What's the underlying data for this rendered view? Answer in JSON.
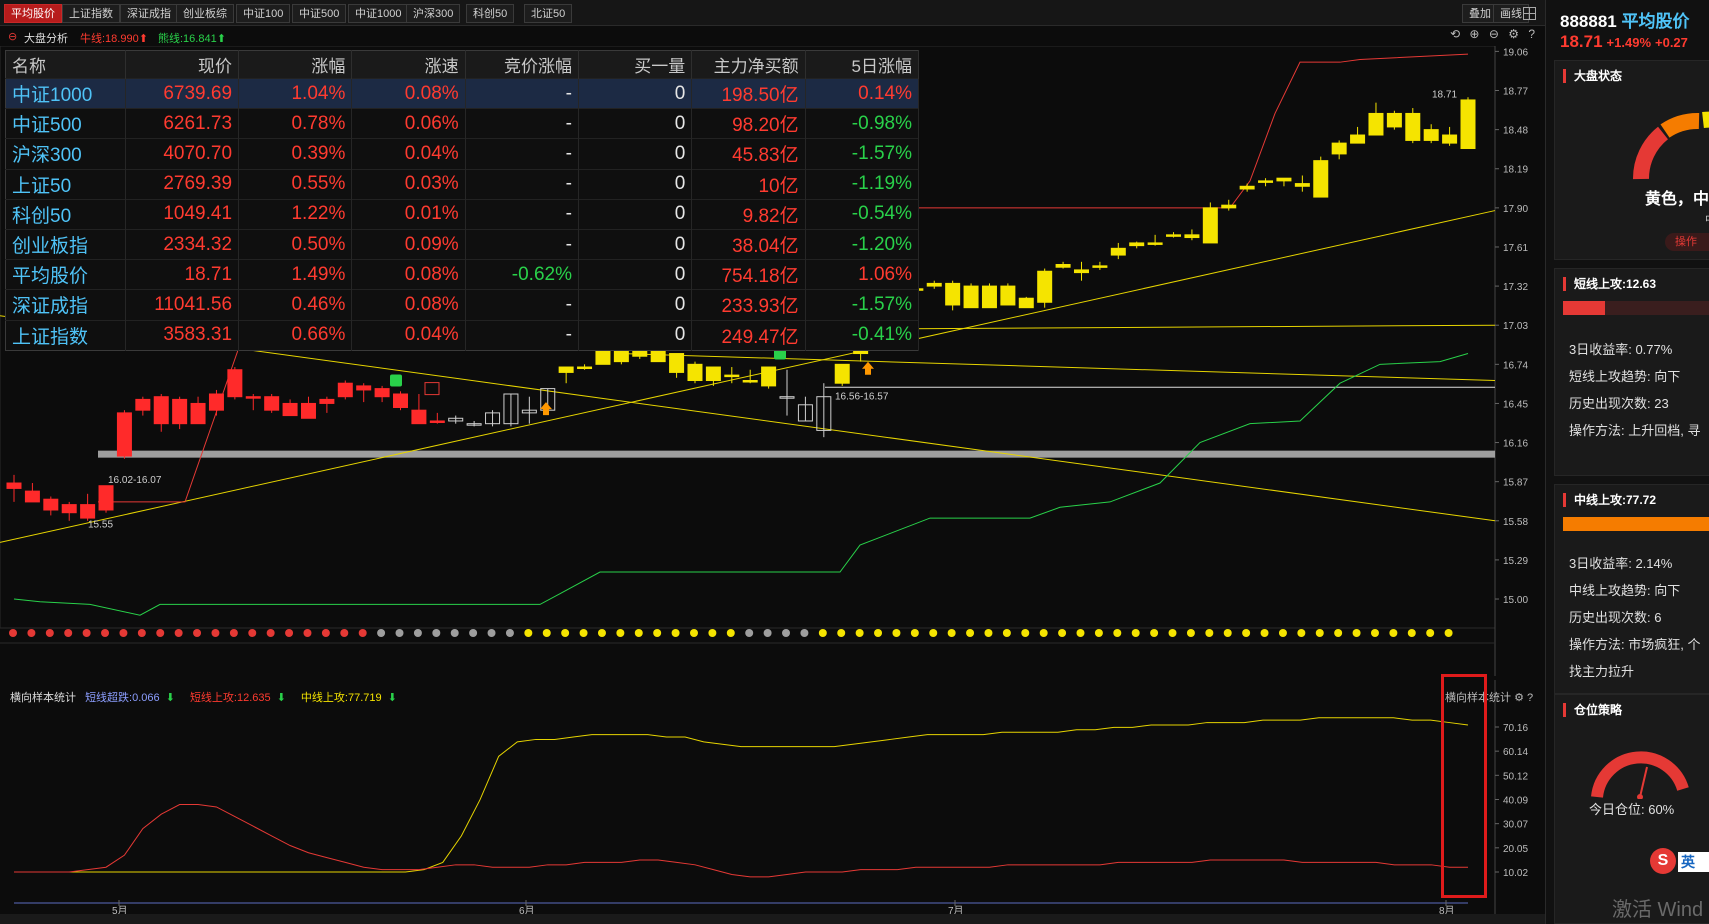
{
  "tabs": [
    "平均股价",
    "上证指数",
    "深证成指",
    "创业板综",
    "中证100",
    "中证500",
    "中证1000",
    "沪深300",
    "科创50",
    "北证50"
  ],
  "active_tab": "平均股价",
  "toolbar": {
    "overlay": "叠加",
    "draw": "画线"
  },
  "info": {
    "analysis": "大盘分析",
    "bull": "牛线:18.990",
    "bear": "熊线:16.841"
  },
  "quote_table": {
    "columns": [
      "名称",
      "现价",
      "涨幅",
      "涨速",
      "竞价涨幅",
      "买一量",
      "主力净买额",
      "5日涨幅"
    ],
    "rows": [
      [
        "中证1000",
        "6739.69",
        "1.04%",
        "0.08%",
        "-",
        "0",
        "198.50亿",
        "0.14%"
      ],
      [
        "中证500",
        "6261.73",
        "0.78%",
        "0.06%",
        "-",
        "0",
        "98.20亿",
        "-0.98%"
      ],
      [
        "沪深300",
        "4070.70",
        "0.39%",
        "0.04%",
        "-",
        "0",
        "45.83亿",
        "-1.57%"
      ],
      [
        "上证50",
        "2769.39",
        "0.55%",
        "0.03%",
        "-",
        "0",
        "10亿",
        "-1.19%"
      ],
      [
        "科创50",
        "1049.41",
        "1.22%",
        "0.01%",
        "-",
        "0",
        "9.82亿",
        "-0.54%"
      ],
      [
        "创业板指",
        "2334.32",
        "0.50%",
        "0.09%",
        "-",
        "0",
        "38.04亿",
        "-1.20%"
      ],
      [
        "平均股价",
        "18.71",
        "1.49%",
        "0.08%",
        "-0.62%",
        "0",
        "754.18亿",
        "1.06%"
      ],
      [
        "深证成指",
        "11041.56",
        "0.46%",
        "0.08%",
        "-",
        "0",
        "233.93亿",
        "-1.57%"
      ],
      [
        "上证指数",
        "3583.31",
        "0.66%",
        "0.04%",
        "-",
        "0",
        "249.47亿",
        "-0.41%"
      ]
    ]
  },
  "chart_data": {
    "type": "candlestick",
    "y_axis_ticks": [
      "19.06",
      "18.77",
      "18.48",
      "18.19",
      "17.90",
      "17.61",
      "17.32",
      "17.03",
      "16.74",
      "16.45",
      "16.16",
      "15.87",
      "15.58",
      "15.29",
      "15.00"
    ],
    "ylim": [
      14.8,
      19.1
    ],
    "x_labels": [
      "5月",
      "6月",
      "7月",
      "8月"
    ],
    "candles": [
      [
        15.82,
        15.92,
        15.72,
        15.86
      ],
      [
        15.8,
        15.86,
        15.72,
        15.72
      ],
      [
        15.74,
        15.76,
        15.62,
        15.66
      ],
      [
        15.7,
        15.72,
        15.58,
        15.64
      ],
      [
        15.7,
        15.78,
        15.58,
        15.6
      ],
      [
        15.66,
        15.84,
        15.64,
        15.84
      ],
      [
        16.06,
        16.4,
        16.04,
        16.38
      ],
      [
        16.4,
        16.5,
        16.36,
        16.48
      ],
      [
        16.3,
        16.52,
        16.24,
        16.5
      ],
      [
        16.3,
        16.5,
        16.26,
        16.48
      ],
      [
        16.3,
        16.5,
        16.3,
        16.45
      ],
      [
        16.4,
        16.55,
        16.36,
        16.52
      ],
      [
        16.5,
        16.72,
        16.48,
        16.7
      ],
      [
        16.5,
        16.52,
        16.4,
        16.5
      ],
      [
        16.5,
        16.52,
        16.38,
        16.4
      ],
      [
        16.45,
        16.48,
        16.36,
        16.36
      ],
      [
        16.45,
        16.5,
        16.34,
        16.34
      ],
      [
        16.45,
        16.5,
        16.38,
        16.48
      ],
      [
        16.5,
        16.62,
        16.48,
        16.6
      ],
      [
        16.55,
        16.6,
        16.46,
        16.58
      ],
      [
        16.5,
        16.58,
        16.46,
        16.56
      ],
      [
        16.42,
        16.54,
        16.4,
        16.52
      ],
      [
        16.4,
        16.52,
        16.3,
        16.3
      ],
      [
        16.32,
        16.38,
        16.3,
        16.32
      ],
      [
        16.32,
        16.36,
        16.3,
        16.34
      ],
      [
        16.3,
        16.32,
        16.28,
        16.3
      ],
      [
        16.3,
        16.4,
        16.28,
        16.38
      ],
      [
        16.3,
        16.52,
        16.28,
        16.52
      ],
      [
        16.4,
        16.5,
        16.3,
        16.38
      ],
      [
        16.4,
        16.56,
        16.38,
        16.56
      ],
      [
        16.68,
        16.72,
        16.6,
        16.72
      ],
      [
        16.72,
        16.74,
        16.7,
        16.72
      ],
      [
        16.74,
        16.9,
        16.74,
        16.88
      ],
      [
        16.76,
        16.9,
        16.74,
        16.9
      ],
      [
        16.8,
        16.88,
        16.78,
        16.86
      ],
      [
        16.88,
        16.9,
        16.76,
        16.76
      ],
      [
        16.68,
        16.82,
        16.64,
        16.82
      ],
      [
        16.62,
        16.76,
        16.6,
        16.74
      ],
      [
        16.62,
        16.72,
        16.58,
        16.72
      ],
      [
        16.66,
        16.72,
        16.6,
        16.66
      ],
      [
        16.62,
        16.7,
        16.6,
        16.62
      ],
      [
        16.58,
        16.72,
        16.56,
        16.72
      ],
      [
        16.5,
        16.7,
        16.36,
        16.5
      ],
      [
        16.44,
        16.5,
        16.32,
        16.32
      ],
      [
        16.25,
        16.6,
        16.2,
        16.5
      ],
      [
        16.6,
        16.74,
        16.58,
        16.74
      ],
      [
        16.82,
        16.86,
        16.76,
        16.84
      ],
      [
        16.92,
        16.98,
        16.88,
        16.94
      ],
      [
        17.1,
        17.16,
        17.06,
        17.12
      ],
      [
        17.3,
        17.34,
        17.28,
        17.3
      ],
      [
        17.34,
        17.36,
        17.3,
        17.32
      ],
      [
        17.34,
        17.36,
        17.14,
        17.18
      ],
      [
        17.32,
        17.34,
        17.16,
        17.16
      ],
      [
        17.32,
        17.34,
        17.16,
        17.16
      ],
      [
        17.32,
        17.34,
        17.18,
        17.18
      ],
      [
        17.23,
        17.24,
        17.16,
        17.16
      ],
      [
        17.43,
        17.45,
        17.16,
        17.2
      ],
      [
        17.46,
        17.5,
        17.45,
        17.48
      ],
      [
        17.44,
        17.5,
        17.36,
        17.42
      ],
      [
        17.47,
        17.5,
        17.44,
        17.47
      ],
      [
        17.55,
        17.64,
        17.52,
        17.6
      ],
      [
        17.64,
        17.65,
        17.6,
        17.62
      ],
      [
        17.63,
        17.7,
        17.62,
        17.64
      ],
      [
        17.7,
        17.72,
        17.68,
        17.7
      ],
      [
        17.68,
        17.74,
        17.66,
        17.7
      ],
      [
        17.9,
        17.94,
        17.64,
        17.64
      ],
      [
        17.92,
        17.96,
        17.88,
        17.9
      ],
      [
        18.06,
        18.08,
        18.02,
        18.04
      ],
      [
        18.1,
        18.12,
        18.06,
        18.1
      ],
      [
        18.1,
        18.12,
        18.06,
        18.12
      ],
      [
        18.08,
        18.14,
        18.02,
        18.06
      ],
      [
        18.25,
        18.28,
        17.98,
        17.98
      ],
      [
        18.3,
        18.4,
        18.26,
        18.38
      ],
      [
        18.44,
        18.5,
        18.38,
        18.38
      ],
      [
        18.6,
        18.68,
        18.44,
        18.44
      ],
      [
        18.6,
        18.62,
        18.48,
        18.5
      ],
      [
        18.6,
        18.64,
        18.38,
        18.4
      ],
      [
        18.48,
        18.52,
        18.38,
        18.4
      ],
      [
        18.44,
        18.5,
        18.36,
        18.38
      ],
      [
        18.7,
        18.72,
        18.34,
        18.34
      ]
    ],
    "annotations": [
      "16.02-16.07",
      "15.55",
      "16.56-16.57",
      "18.71"
    ],
    "sub_y_ticks": [
      "70.16",
      "60.14",
      "50.12",
      "40.09",
      "30.07",
      "20.05",
      "10.02"
    ],
    "sub_legend": {
      "title": "横向样本统计",
      "s1": "短线超跌:0.066",
      "s2": "短线上攻:12.635",
      "s3": "中线上攻:77.719"
    },
    "sub_series": {
      "yellow": [
        10,
        10,
        10,
        10,
        10,
        10,
        10,
        10,
        10,
        10,
        10,
        10,
        10,
        10,
        10,
        10,
        10,
        10,
        10,
        10,
        10,
        10,
        11,
        14,
        25,
        40,
        58,
        64,
        65,
        65,
        66,
        67,
        67,
        67,
        67,
        66,
        66,
        64,
        63,
        62,
        62,
        62,
        62,
        62,
        62,
        63,
        64,
        65,
        66,
        67,
        67,
        67,
        67,
        68,
        68,
        68,
        68,
        69,
        69,
        70,
        70,
        71,
        71,
        71,
        72,
        72,
        72,
        73,
        73,
        73,
        74,
        74,
        74,
        74,
        74,
        73,
        73,
        72,
        71
      ],
      "red": [
        10,
        10,
        10,
        10,
        11,
        12,
        17,
        28,
        34,
        38,
        38,
        37,
        33,
        29,
        25,
        21,
        18,
        16,
        14,
        12,
        11,
        11,
        11,
        12,
        13,
        13,
        12,
        12,
        12,
        13,
        13,
        14,
        14,
        14,
        15,
        15,
        14,
        13,
        11,
        9,
        8,
        8,
        9,
        10,
        10,
        10,
        11,
        11,
        11,
        12,
        12,
        12,
        12,
        12,
        13,
        13,
        13,
        13,
        13,
        13,
        14,
        14,
        14,
        14,
        14,
        15,
        15,
        15,
        15,
        15,
        14,
        14,
        14,
        14,
        14,
        13,
        13,
        13,
        12,
        12
      ]
    },
    "sub_right_label": "横向样本统计"
  },
  "right_panel": {
    "code": "888881",
    "name": "平均股价",
    "price": "18.71",
    "change_pct": "+1.49%",
    "change_abs": "+0.27",
    "market_state_title": "大盘状态",
    "market_state_value": "黄色，中",
    "market_state_sub": "中",
    "operate_btn": "操作",
    "short_title": "短线上攻:12.63",
    "short_lines": [
      "3日收益率: 0.77%",
      "短线上攻趋势: 向下",
      "历史出现次数: 23",
      "操作方法: 上升回档, 寻"
    ],
    "mid_title": "中线上攻:77.72",
    "mid_lines": [
      "3日收益率: 2.14%",
      "中线上攻趋势: 向下",
      "历史出现次数: 6",
      "操作方法: 市场疯狂, 个",
      "找主力拉升"
    ],
    "position_title": "仓位策略",
    "position_value": "今日仓位: 60%",
    "watermark": "激活 Wind",
    "ime_label": "英"
  }
}
